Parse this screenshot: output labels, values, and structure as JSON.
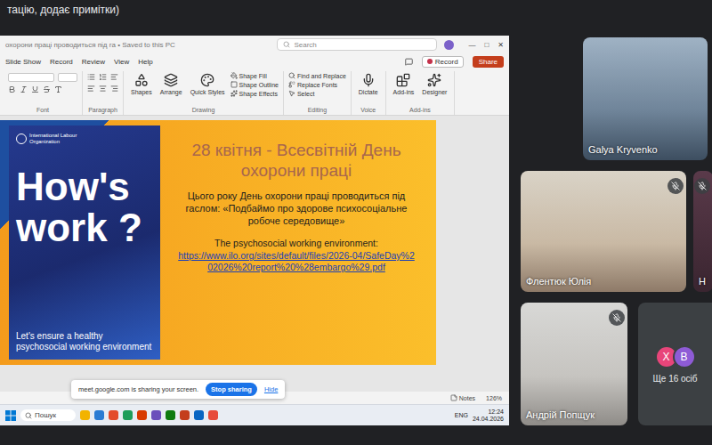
{
  "meet": {
    "caption": "тацію, додає примітки)"
  },
  "powerpoint": {
    "tab_title": "охорони праці проводиться під га",
    "saved": "Saved to this PC",
    "search": {
      "placeholder": "Search"
    },
    "window_controls": [
      "—",
      "□",
      "✕"
    ],
    "menu": [
      "Slide Show",
      "Record",
      "Review",
      "View",
      "Help"
    ],
    "record": "Record",
    "share": "Share",
    "ribbon": [
      {
        "label": "Font",
        "kind": "font",
        "buttons": []
      },
      {
        "label": "Paragraph",
        "kind": "paragraph",
        "buttons": []
      },
      {
        "label": "Drawing",
        "kind": "buttons",
        "buttons": [
          {
            "label": "Shapes",
            "kind": "large"
          },
          {
            "label": "Arrange",
            "kind": "large"
          },
          {
            "label": "Quick Styles",
            "kind": "large"
          },
          {
            "label": "Shape Fill",
            "kind": "small"
          },
          {
            "label": "Shape Outline",
            "kind": "small"
          },
          {
            "label": "Shape Effects",
            "kind": "small"
          }
        ]
      },
      {
        "label": "Editing",
        "kind": "buttons",
        "buttons": [
          {
            "label": "Find and Replace",
            "kind": "small"
          },
          {
            "label": "Replace Fonts",
            "kind": "small"
          },
          {
            "label": "Select",
            "kind": "small"
          }
        ]
      },
      {
        "label": "Voice",
        "kind": "buttons",
        "buttons": [
          {
            "label": "Dictate",
            "kind": "large"
          }
        ]
      },
      {
        "label": "Add-ins",
        "kind": "buttons",
        "buttons": [
          {
            "label": "Add-ins",
            "kind": "large"
          },
          {
            "label": "Designer",
            "kind": "large"
          }
        ]
      }
    ],
    "slide": {
      "poster": {
        "org": "International Labour Organization",
        "headline": "How's work ?",
        "tagline": "Let's ensure a healthy psychosocial working environment"
      },
      "title": "28 квітня - Всесвітній День охорони праці",
      "body": "Цього року День охорони праці проводиться під гаслом: «Подбаймо про здорове психосоціальне робоче середовище»",
      "link_caption": "The psychosocial working environment:",
      "link": "https://www.ilo.org/sites/default/files/2026-04/SafeDay%202026%20report%20%28embargo%29.pdf"
    },
    "status_bar": {
      "notes": "Notes",
      "zoom": "126%"
    }
  },
  "share_bar": {
    "message": "meet.google.com is sharing your screen.",
    "stop": "Stop sharing",
    "hide": "Hide"
  },
  "taskbar": {
    "search": "Пошук",
    "lang": "ENG",
    "time": "12:24",
    "date": "24.04.2026"
  },
  "participants": [
    {
      "name": "Galya Kryvenko",
      "muted": false
    },
    {
      "name": "Флентюк Юлія",
      "muted": true
    },
    {
      "name": "Н",
      "muted": true
    },
    {
      "name": "Андрій Попщук",
      "muted": true
    }
  ],
  "more_people": {
    "label": "Ще 16 осіб",
    "avatars": [
      {
        "letter": "Х",
        "color": "#e8457a"
      },
      {
        "letter": "В",
        "color": "#8e5bd6"
      }
    ]
  }
}
